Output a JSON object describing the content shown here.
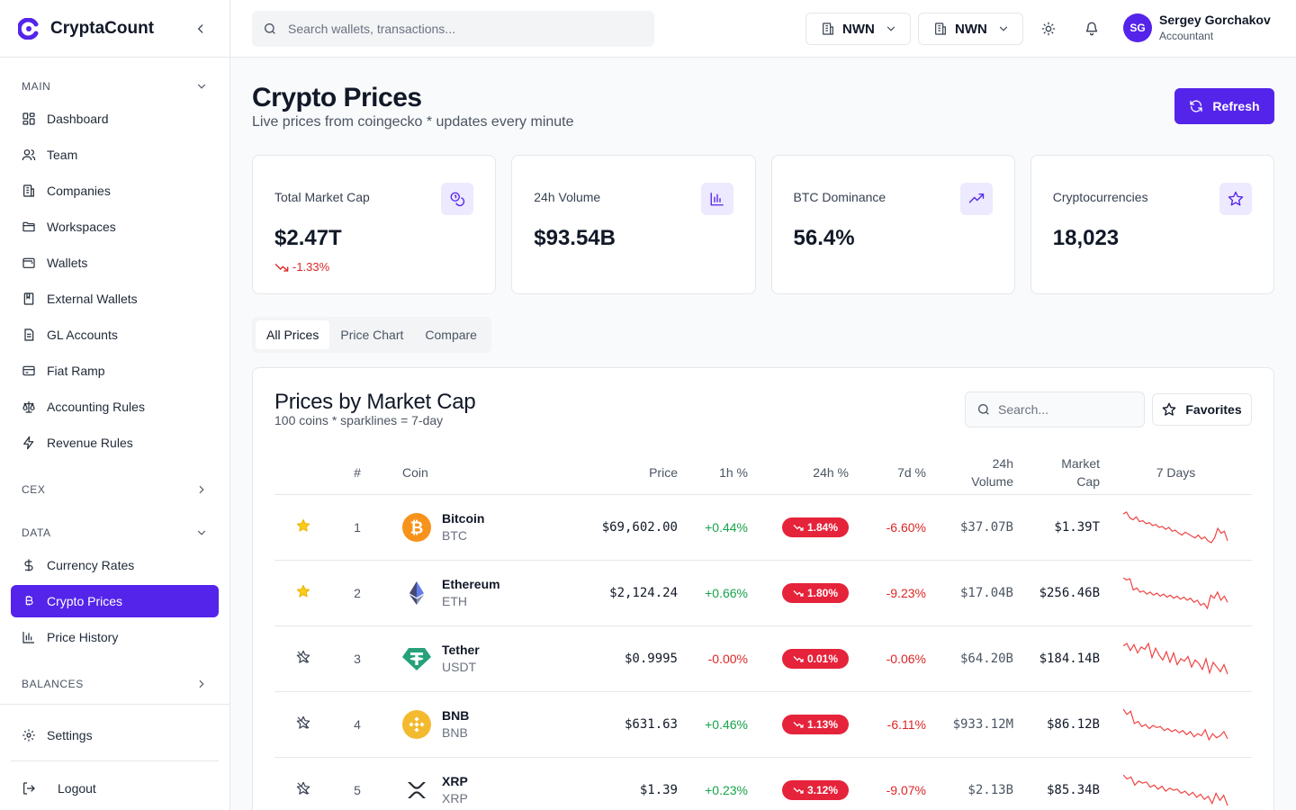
{
  "app": {
    "name": "CryptaCount"
  },
  "sidebar": {
    "sections": {
      "main": "MAIN",
      "cex": "CEX",
      "data": "DATA",
      "balances": "BALANCES"
    },
    "main_items": [
      {
        "label": "Dashboard",
        "icon": "grid-icon"
      },
      {
        "label": "Team",
        "icon": "users-icon"
      },
      {
        "label": "Companies",
        "icon": "building-icon"
      },
      {
        "label": "Workspaces",
        "icon": "folder-icon"
      },
      {
        "label": "Wallets",
        "icon": "wallet-icon"
      },
      {
        "label": "External Wallets",
        "icon": "book-icon"
      },
      {
        "label": "GL Accounts",
        "icon": "file-icon"
      },
      {
        "label": "Fiat Ramp",
        "icon": "card-icon"
      },
      {
        "label": "Accounting Rules",
        "icon": "scale-icon"
      },
      {
        "label": "Revenue Rules",
        "icon": "zap-icon"
      }
    ],
    "data_items": [
      {
        "label": "Currency Rates",
        "icon": "dollar-icon"
      },
      {
        "label": "Crypto Prices",
        "icon": "bitcoin-icon",
        "active": true
      },
      {
        "label": "Price History",
        "icon": "bar-chart-icon"
      }
    ],
    "settings": "Settings",
    "logout": "Logout"
  },
  "topbar": {
    "search_placeholder": "Search wallets, transactions...",
    "org1": "NWN",
    "org2": "NWN",
    "user": {
      "initials": "SG",
      "name": "Sergey Gorchakov",
      "role": "Accountant"
    }
  },
  "page": {
    "title": "Crypto Prices",
    "subtitle": "Live prices from coingecko * updates every minute",
    "refresh": "Refresh"
  },
  "stats": [
    {
      "label": "Total Market Cap",
      "value": "$2.47T",
      "change": "-1.33%",
      "icon": "coins-icon"
    },
    {
      "label": "24h Volume",
      "value": "$93.54B",
      "icon": "bar-chart-icon"
    },
    {
      "label": "BTC Dominance",
      "value": "56.4%",
      "icon": "trending-up-icon"
    },
    {
      "label": "Cryptocurrencies",
      "value": "18,023",
      "icon": "star-icon"
    }
  ],
  "tabs": [
    "All Prices",
    "Price Chart",
    "Compare"
  ],
  "card": {
    "title": "Prices by Market Cap",
    "subtitle": "100 coins * sparklines = 7-day",
    "search_placeholder": "Search...",
    "favorites": "Favorites"
  },
  "table": {
    "headers": {
      "rank": "#",
      "coin": "Coin",
      "price": "Price",
      "h1": "1h %",
      "h24": "24h %",
      "d7": "7d %",
      "vol_1": "24h",
      "vol_2": "Volume",
      "cap_1": "Market",
      "cap_2": "Cap",
      "days": "7 Days"
    },
    "rows": [
      {
        "fav": true,
        "rank": "1",
        "name": "Bitcoin",
        "sym": "BTC",
        "price": "$69,602.00",
        "h1": "+0.44%",
        "h24": "1.84%",
        "d7": "-6.60%",
        "vol": "$37.07B",
        "cap": "$1.39T",
        "icon": "bitcoin-logo-icon",
        "spark": [
          30,
          28,
          34,
          36,
          33,
          38,
          37,
          40,
          39,
          42,
          41,
          44,
          43,
          46,
          44,
          48,
          47,
          50,
          52,
          49,
          51,
          53,
          55,
          52,
          56,
          54,
          58,
          60,
          55,
          45,
          50,
          48,
          58
        ]
      },
      {
        "fav": true,
        "rank": "2",
        "name": "Ethereum",
        "sym": "ETH",
        "price": "$2,124.24",
        "h1": "+0.66%",
        "h24": "1.80%",
        "d7": "-9.23%",
        "vol": "$17.04B",
        "cap": "$256.46B",
        "icon": "ethereum-logo-icon",
        "spark": [
          28,
          30,
          29,
          40,
          38,
          42,
          41,
          44,
          42,
          45,
          43,
          46,
          44,
          47,
          45,
          48,
          46,
          49,
          47,
          50,
          48,
          52,
          50,
          55,
          53,
          58,
          45,
          48,
          42,
          50,
          46,
          52
        ]
      },
      {
        "fav": false,
        "rank": "3",
        "name": "Tether",
        "sym": "USDT",
        "price": "$0.9995",
        "h1": "-0.00%",
        "h24": "0.01%",
        "d7": "-0.06%",
        "vol": "$64.20B",
        "cap": "$184.14B",
        "icon": "tether-logo-icon",
        "spark": [
          32,
          30,
          36,
          31,
          38,
          33,
          35,
          30,
          42,
          34,
          40,
          44,
          37,
          46,
          38,
          48,
          43,
          45,
          41,
          50,
          44,
          47,
          52,
          43,
          55,
          46,
          50,
          54,
          48,
          56
        ]
      },
      {
        "fav": false,
        "rank": "4",
        "name": "BNB",
        "sym": "BNB",
        "price": "$631.63",
        "h1": "+0.46%",
        "h24": "1.13%",
        "d7": "-6.11%",
        "vol": "$933.12M",
        "cap": "$86.12B",
        "icon": "bnb-logo-icon",
        "spark": [
          28,
          33,
          30,
          42,
          40,
          45,
          43,
          47,
          44,
          46,
          45,
          49,
          47,
          50,
          48,
          51,
          49,
          53,
          50,
          55,
          52,
          54,
          48,
          58,
          52,
          56,
          54,
          50,
          57
        ]
      },
      {
        "fav": false,
        "rank": "5",
        "name": "XRP",
        "sym": "XRP",
        "price": "$1.39",
        "h1": "+0.23%",
        "h24": "3.12%",
        "d7": "-9.07%",
        "vol": "$2.13B",
        "cap": "$85.34B",
        "icon": "xrp-logo-icon",
        "spark": [
          30,
          34,
          32,
          40,
          36,
          38,
          37,
          42,
          40,
          44,
          41,
          46,
          43,
          45,
          44,
          48,
          46,
          50,
          47,
          52,
          49,
          54,
          51,
          58,
          48,
          55,
          50,
          60
        ]
      }
    ]
  },
  "colors": {
    "accent": "#5524ea",
    "negative": "#dc2626",
    "positive": "#16a34a",
    "badge": "#e5233a"
  }
}
